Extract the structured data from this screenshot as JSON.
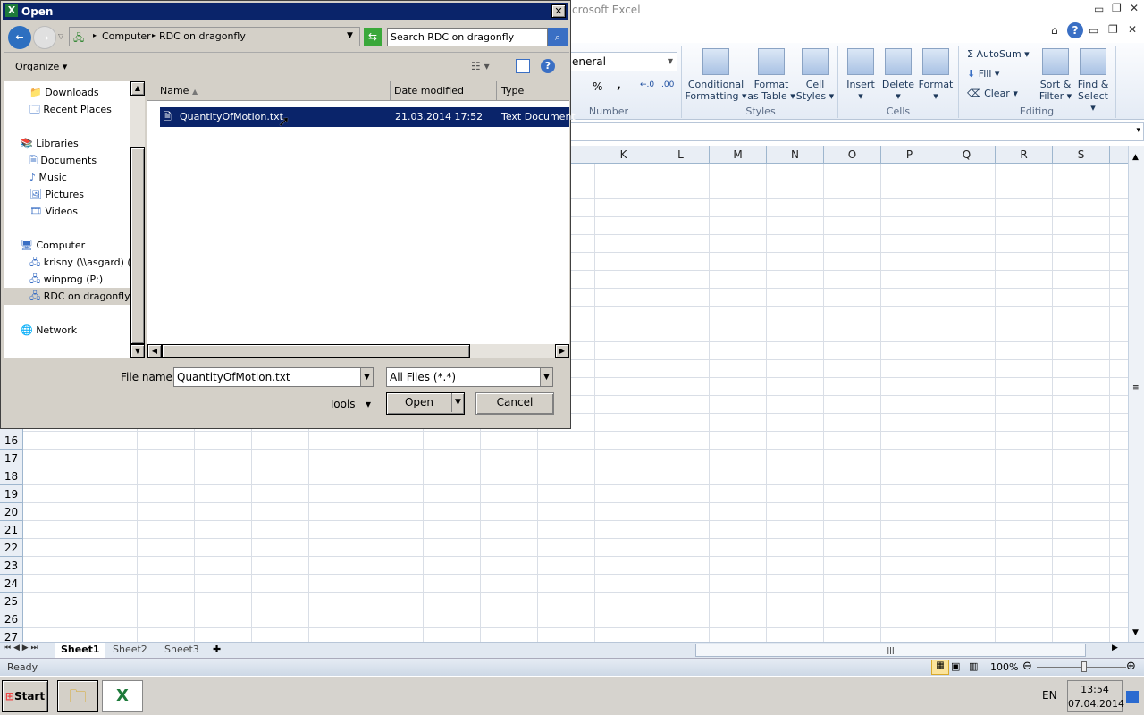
{
  "excel": {
    "title": "crosoft Excel",
    "number_format": "eneral",
    "groups": {
      "number": "Number",
      "styles": "Styles",
      "cells": "Cells",
      "editing": "Editing"
    },
    "buttons": {
      "conditional_formatting": [
        "Conditional",
        "Formatting ▾"
      ],
      "format_as_table": [
        "Format",
        "as Table ▾"
      ],
      "cell_styles": [
        "Cell",
        "Styles ▾"
      ],
      "insert": "Insert",
      "delete": "Delete",
      "format": "Format",
      "autosum": "Σ  AutoSum ▾",
      "fill": "Fill ▾",
      "clear": "Clear ▾",
      "sort_filter": [
        "Sort &",
        "Filter ▾"
      ],
      "find_select": [
        "Find &",
        "Select ▾"
      ],
      "percent": "%",
      "comma": ","
    },
    "columns": [
      "K",
      "L",
      "M",
      "N",
      "O",
      "P",
      "Q",
      "R",
      "S"
    ],
    "rows": [
      "16",
      "17",
      "18",
      "19",
      "20",
      "21",
      "22",
      "23",
      "24",
      "25",
      "26",
      "27"
    ],
    "sheets": [
      "Sheet1",
      "Sheet2",
      "Sheet3"
    ],
    "active_sheet": "Sheet1",
    "status": "Ready",
    "zoom": "100%",
    "zoom_level_percent": 100
  },
  "dialog": {
    "title": "Open",
    "breadcrumb": [
      "Computer",
      "RDC on dragonfly"
    ],
    "search_placeholder": "Search RDC on dragonfly",
    "organize": "Organize",
    "nav": [
      {
        "label": "Downloads",
        "icon": "downloads-icon"
      },
      {
        "label": "Recent Places",
        "icon": "recent-places-icon"
      },
      {
        "label": "Libraries",
        "icon": "libraries-icon"
      },
      {
        "label": "Documents",
        "icon": "documents-icon"
      },
      {
        "label": "Music",
        "icon": "music-icon"
      },
      {
        "label": "Pictures",
        "icon": "pictures-icon"
      },
      {
        "label": "Videos",
        "icon": "videos-icon"
      },
      {
        "label": "Computer",
        "icon": "computer-icon"
      },
      {
        "label": "krisny (\\\\asgard) (M",
        "icon": "network-drive-icon"
      },
      {
        "label": "winprog (P:)",
        "icon": "network-drive-icon"
      },
      {
        "label": "RDC on dragonfly",
        "icon": "network-drive-icon",
        "selected": true
      },
      {
        "label": "Network",
        "icon": "network-icon"
      }
    ],
    "columns": {
      "name": "Name",
      "date": "Date modified",
      "type": "Type"
    },
    "files": [
      {
        "name": "QuantityOfMotion.txt",
        "date": "21.03.2014 17:52",
        "type": "Text Document",
        "selected": true
      }
    ],
    "file_name_label": "File name:",
    "file_name_value": "QuantityOfMotion.txt",
    "file_type": "All Files (*.*)",
    "tools": "Tools",
    "open": "Open",
    "cancel": "Cancel"
  },
  "taskbar": {
    "start": "Start",
    "lang": "EN",
    "time": "13:54",
    "date": "07.04.2014"
  }
}
